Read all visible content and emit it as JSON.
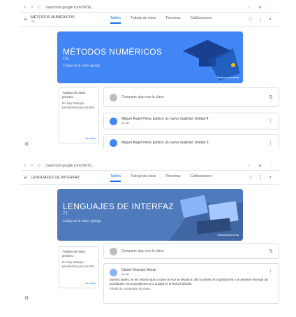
{
  "colors": {
    "accent": "#1a73e8",
    "banner1": "#4285f4",
    "banner2": "#4f7bbd"
  },
  "shot1": {
    "browser": {
      "url": "classroom.google.com/c/MTE...",
      "controls": "< > C",
      "right_icons": "☆ ⊕ ⋮"
    },
    "course": "MÉTODOS NUMÉRICOS",
    "course_sub": "ITA",
    "tabs": [
      "Tablón",
      "Trabajo de clase",
      "Personas",
      "Calificaciones"
    ],
    "banner": {
      "title": "MÉTODOS NUMÉRICOS",
      "section": "ITA",
      "link": "Código de la clase: gpvxj2j",
      "button": "Seleccionar tema"
    },
    "side": {
      "title": "Trabajo de clase próximo",
      "text": "No hay trabajos pendientes para pronto",
      "link": "Ver todo"
    },
    "compose": "Comparte algo con la clase",
    "posts": [
      {
        "title": "Miguel Ángel Pérez publicó un nuevo material: Unidad 4",
        "date": "16 abr"
      },
      {
        "title": "Miguel Ángel Pérez publicó un nuevo material: Unidad 3"
      }
    ]
  },
  "shot2": {
    "browser": {
      "url": "classroom.google.com/c/MTU...",
      "controls": "< > C",
      "right_icons": "☆ ⊕ ⋮"
    },
    "course": "LENGUAJES DE INTERFAZ",
    "tabs": [
      "Tablón",
      "Trabajo de clase",
      "Personas",
      "Calificaciones"
    ],
    "banner": {
      "title": "LENGUAJES DE INTERFAZ",
      "section": "7T",
      "link": "Código de la clase: xy5kqyr",
      "button": "Seleccionar tema"
    },
    "side": {
      "title": "Trabajo de clase próximo",
      "text": "No hay trabajos pendientes para pronto",
      "link": "Ver todo"
    },
    "compose": "Comparte algo con la clase",
    "post": {
      "author": "Daniel Ocampo Morán",
      "date": "16 abr",
      "body": "Buenas tardes, se les informa que la clase de hoy se llevará a cabo a través de la plataforma y se deberán entregar las actividades correspondientes a la unidad en la fecha indicada.",
      "more": "Añadir un comentario de clase..."
    }
  }
}
